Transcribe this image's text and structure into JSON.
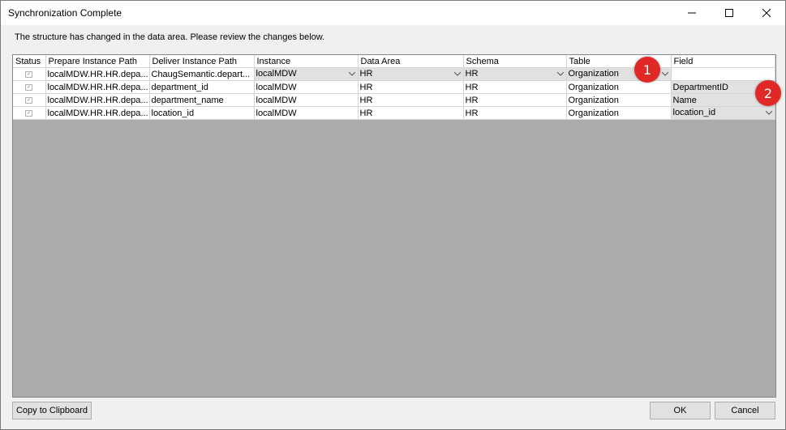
{
  "window": {
    "title": "Synchronization Complete"
  },
  "message": "The structure has changed in the data area. Please review the changes below.",
  "columns": [
    "Status",
    "Prepare Instance Path",
    "Deliver Instance Path",
    "Instance",
    "Data Area",
    "Schema",
    "Table",
    "Field"
  ],
  "rows": [
    {
      "prepare": "localMDW.HR.HR.depa...",
      "deliver": "ChaugSemantic.depart...",
      "instance": "localMDW",
      "data_area": "HR",
      "schema": "HR",
      "table": "Organization",
      "field": ""
    },
    {
      "prepare": "localMDW.HR.HR.depa...",
      "deliver": "department_id",
      "instance": "localMDW",
      "data_area": "HR",
      "schema": "HR",
      "table": "Organization",
      "field": "DepartmentID"
    },
    {
      "prepare": "localMDW.HR.HR.depa...",
      "deliver": "department_name",
      "instance": "localMDW",
      "data_area": "HR",
      "schema": "HR",
      "table": "Organization",
      "field": "Name"
    },
    {
      "prepare": "localMDW.HR.HR.depa...",
      "deliver": "location_id",
      "instance": "localMDW",
      "data_area": "HR",
      "schema": "HR",
      "table": "Organization",
      "field": "location_id"
    }
  ],
  "callouts": [
    "1",
    "2"
  ],
  "buttons": {
    "copy": "Copy to Clipboard",
    "ok": "OK",
    "cancel": "Cancel"
  },
  "icons": {
    "minimize": "minimize-icon",
    "maximize": "maximize-icon",
    "close": "close-icon",
    "dropdown": "chevron-down-icon",
    "status": "checkbox-icon"
  },
  "colors": {
    "callout": "#e02826",
    "grid_background": "#ababab",
    "window_background": "#f0f0f0"
  }
}
